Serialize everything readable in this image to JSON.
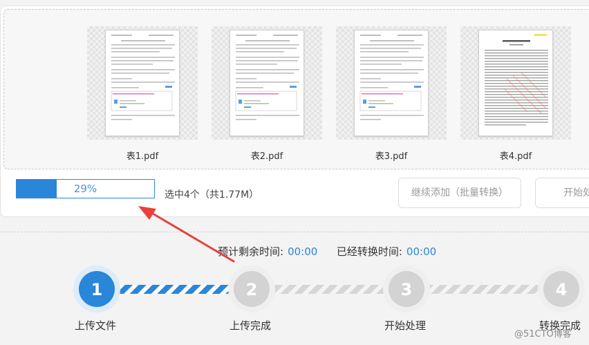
{
  "files": [
    {
      "name": "表1.pdf"
    },
    {
      "name": "表2.pdf"
    },
    {
      "name": "表3.pdf"
    },
    {
      "name": "表4.pdf"
    }
  ],
  "progress": {
    "percent": 29,
    "label": "29%"
  },
  "selection": {
    "summary": "选中4个（共1.77M）"
  },
  "buttons": {
    "continue_add": "继续添加（批量转换）",
    "start": "开始处"
  },
  "times": {
    "remaining_label": "预计剩余时间:",
    "remaining_value": "00:00",
    "elapsed_label": "已经转换时间:",
    "elapsed_value": "00:00"
  },
  "steps": [
    {
      "number": "1",
      "label": "上传文件",
      "state": "active"
    },
    {
      "number": "2",
      "label": "上传完成",
      "state": "pending"
    },
    {
      "number": "3",
      "label": "开始处理",
      "state": "pending"
    },
    {
      "number": "4",
      "label": "转换完成",
      "state": "pending"
    }
  ],
  "watermark": "@51CTO博客",
  "colors": {
    "accent": "#2a86d9",
    "pending": "#d3d3d3",
    "arrow": "#e8413c"
  }
}
